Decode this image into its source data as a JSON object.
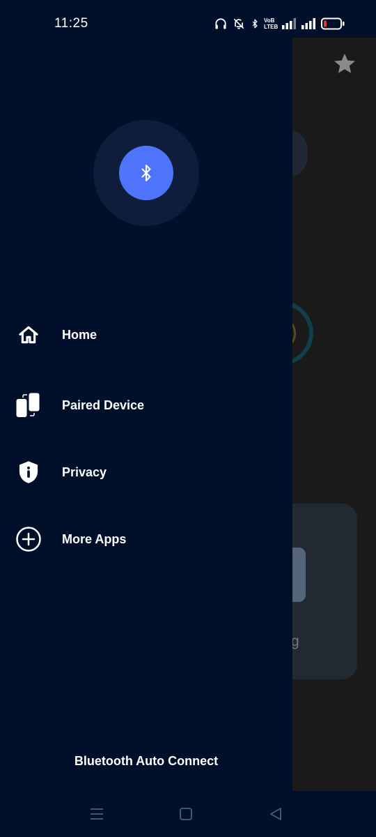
{
  "status_bar": {
    "time": "11:25",
    "icons": [
      "headphones-icon",
      "mute-icon",
      "bluetooth-icon",
      "volte-icon",
      "signal-icon",
      "signal-icon",
      "battery-low-icon"
    ],
    "volte_top": "VoB",
    "volte_bottom": "LTEB"
  },
  "drawer": {
    "logo_icon": "bluetooth-icon",
    "menu": [
      {
        "label": "Home",
        "icon": "home-icon"
      },
      {
        "label": "Paired Device",
        "icon": "paired-device-icon"
      },
      {
        "label": "Privacy",
        "icon": "shield-info-icon"
      },
      {
        "label": "More Apps",
        "icon": "plus-circle-icon"
      }
    ],
    "footer": "Bluetooth Auto Connect"
  },
  "background": {
    "fragment_text": "g"
  },
  "colors": {
    "drawer_bg": "#000f2a",
    "accent": "#4d74fb",
    "halo": "#0f1d3c",
    "battery_low": "#e53935"
  },
  "nav_bar": {
    "buttons": [
      "menu-icon",
      "home-square-icon",
      "back-icon"
    ]
  }
}
